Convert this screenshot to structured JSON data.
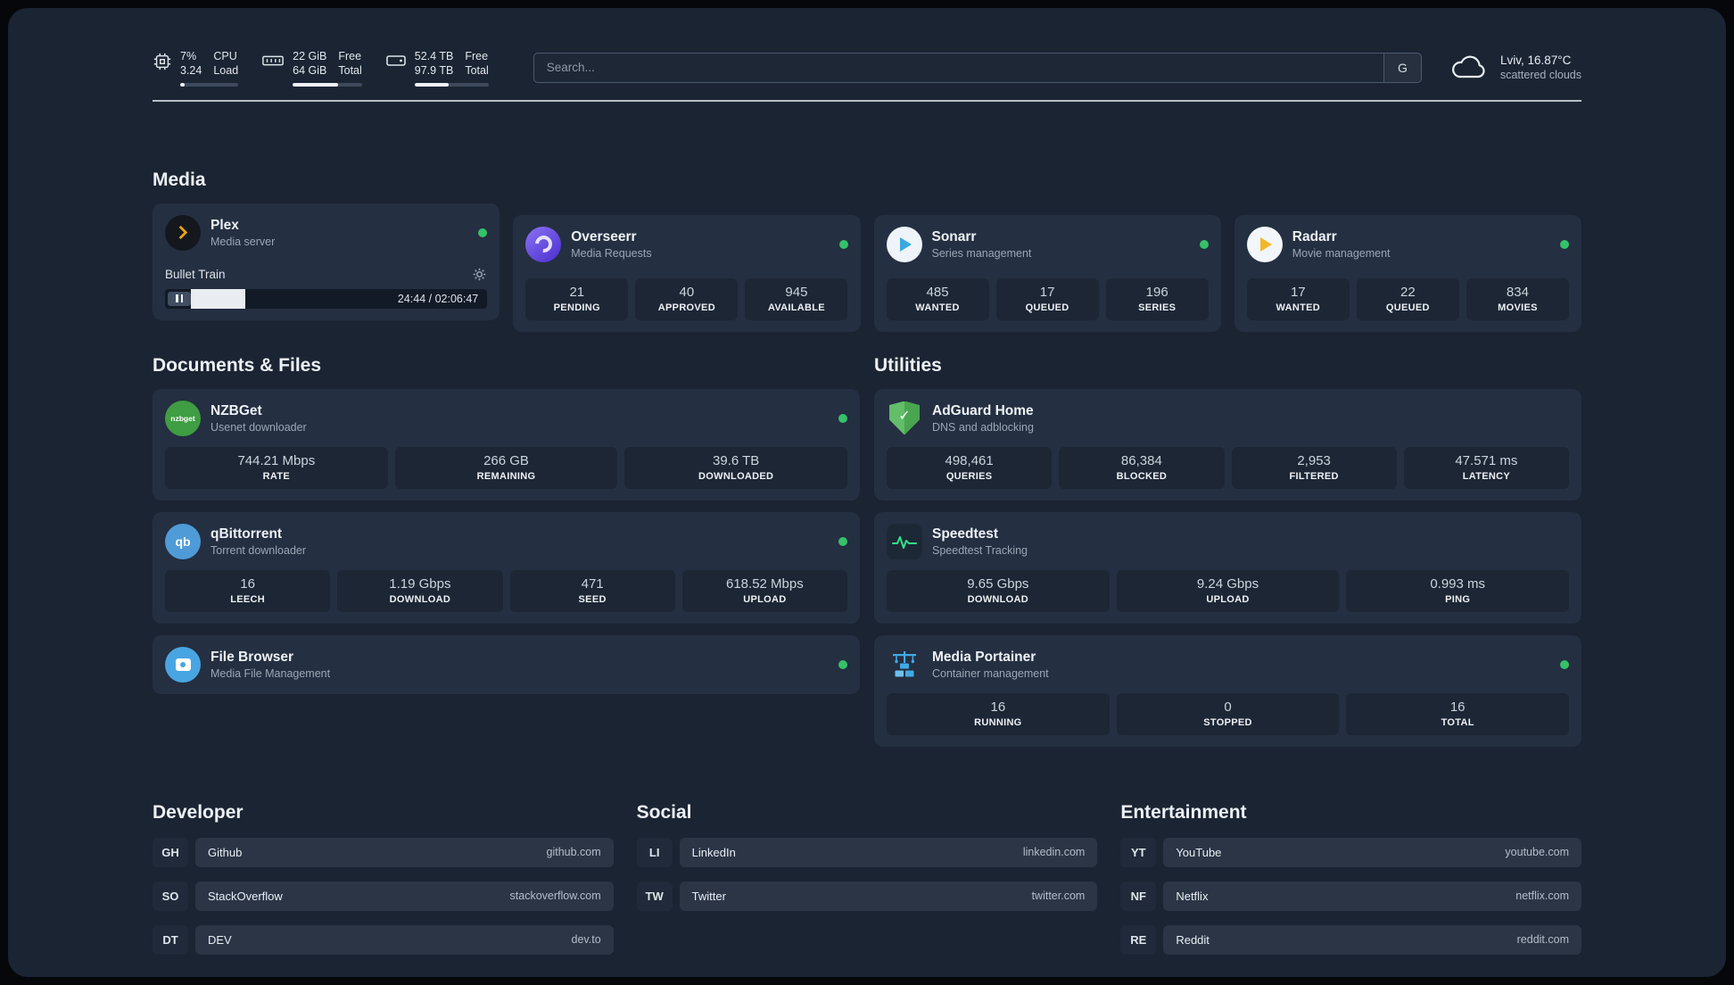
{
  "topbar": {
    "cpu": {
      "icon": "cpu-icon",
      "percent": "7%",
      "load": "3.24",
      "label1": "CPU",
      "label2": "Load",
      "bar": "7%"
    },
    "ram": {
      "icon": "ram-icon",
      "free": "22 GiB",
      "total": "64 GiB",
      "label1": "Free",
      "label2": "Total",
      "bar": "66%"
    },
    "disk": {
      "icon": "disk-icon",
      "free": "52.4 TB",
      "total": "97.9 TB",
      "label1": "Free",
      "label2": "Total",
      "bar": "46%"
    },
    "search": {
      "placeholder": "Search...",
      "engine_label": "G",
      "icon": "search-engine-google"
    },
    "weather": {
      "icon": "cloud-icon",
      "location": "Lviv, 16.87°C",
      "condition": "scattered clouds"
    }
  },
  "sections": {
    "media": {
      "title": "Media",
      "plex": {
        "icon": "plex-icon",
        "name": "Plex",
        "desc": "Media server",
        "player": {
          "track": "Bullet Train",
          "time": "24:44 / 02:06:47",
          "progress": "17%"
        }
      },
      "overseerr": {
        "icon": "overseerr-icon",
        "name": "Overseerr",
        "desc": "Media Requests",
        "stats": [
          {
            "value": "21",
            "label": "PENDING"
          },
          {
            "value": "40",
            "label": "APPROVED"
          },
          {
            "value": "945",
            "label": "AVAILABLE"
          }
        ]
      },
      "sonarr": {
        "icon": "sonarr-icon",
        "name": "Sonarr",
        "desc": "Series management",
        "stats": [
          {
            "value": "485",
            "label": "WANTED"
          },
          {
            "value": "17",
            "label": "QUEUED"
          },
          {
            "value": "196",
            "label": "SERIES"
          }
        ]
      },
      "radarr": {
        "icon": "radarr-icon",
        "name": "Radarr",
        "desc": "Movie management",
        "stats": [
          {
            "value": "17",
            "label": "WANTED"
          },
          {
            "value": "22",
            "label": "QUEUED"
          },
          {
            "value": "834",
            "label": "MOVIES"
          }
        ]
      }
    },
    "documents": {
      "title": "Documents & Files",
      "nzbget": {
        "icon": "nzbget-icon",
        "icon_text": "nzbget",
        "name": "NZBGet",
        "desc": "Usenet downloader",
        "stats": [
          {
            "value": "744.21 Mbps",
            "label": "RATE"
          },
          {
            "value": "266 GB",
            "label": "REMAINING"
          },
          {
            "value": "39.6 TB",
            "label": "DOWNLOADED"
          }
        ]
      },
      "qbittorrent": {
        "icon": "qbittorrent-icon",
        "icon_text": "qb",
        "name": "qBittorrent",
        "desc": "Torrent downloader",
        "stats": [
          {
            "value": "16",
            "label": "LEECH"
          },
          {
            "value": "1.19 Gbps",
            "label": "DOWNLOAD"
          },
          {
            "value": "471",
            "label": "SEED"
          },
          {
            "value": "618.52 Mbps",
            "label": "UPLOAD"
          }
        ]
      },
      "filebrowser": {
        "icon": "filebrowser-icon",
        "name": "File Browser",
        "desc": "Media File Management"
      }
    },
    "utilities": {
      "title": "Utilities",
      "adguard": {
        "icon": "adguard-icon",
        "icon_glyph": "✓",
        "name": "AdGuard Home",
        "desc": "DNS and adblocking",
        "stats": [
          {
            "value": "498,461",
            "label": "QUERIES"
          },
          {
            "value": "86,384",
            "label": "BLOCKED"
          },
          {
            "value": "2,953",
            "label": "FILTERED"
          },
          {
            "value": "47.571 ms",
            "label": "LATENCY"
          }
        ]
      },
      "speedtest": {
        "icon": "speedtest-icon",
        "name": "Speedtest",
        "desc": "Speedtest Tracking",
        "stats": [
          {
            "value": "9.65 Gbps",
            "label": "DOWNLOAD"
          },
          {
            "value": "9.24 Gbps",
            "label": "UPLOAD"
          },
          {
            "value": "0.993 ms",
            "label": "PING"
          }
        ]
      },
      "portainer": {
        "icon": "portainer-icon",
        "name": "Media Portainer",
        "desc": "Container management",
        "stats": [
          {
            "value": "16",
            "label": "RUNNING"
          },
          {
            "value": "0",
            "label": "STOPPED"
          },
          {
            "value": "16",
            "label": "TOTAL"
          }
        ]
      }
    },
    "bookmarks": {
      "developer": {
        "title": "Developer",
        "items": [
          {
            "initials": "GH",
            "name": "Github",
            "url": "github.com"
          },
          {
            "initials": "SO",
            "name": "StackOverflow",
            "url": "stackoverflow.com"
          },
          {
            "initials": "DT",
            "name": "DEV",
            "url": "dev.to"
          }
        ]
      },
      "social": {
        "title": "Social",
        "items": [
          {
            "initials": "LI",
            "name": "LinkedIn",
            "url": "linkedin.com"
          },
          {
            "initials": "TW",
            "name": "Twitter",
            "url": "twitter.com"
          }
        ]
      },
      "entertainment": {
        "title": "Entertainment",
        "items": [
          {
            "initials": "YT",
            "name": "YouTube",
            "url": "youtube.com"
          },
          {
            "initials": "NF",
            "name": "Netflix",
            "url": "netflix.com"
          },
          {
            "initials": "RE",
            "name": "Reddit",
            "url": "reddit.com"
          }
        ]
      }
    }
  },
  "colors": {
    "status_online": "#35c06a",
    "background": "#1b2433",
    "card": "#242f41",
    "stat_tile": "#1c2635",
    "plex_accent": "#e8a40c"
  }
}
